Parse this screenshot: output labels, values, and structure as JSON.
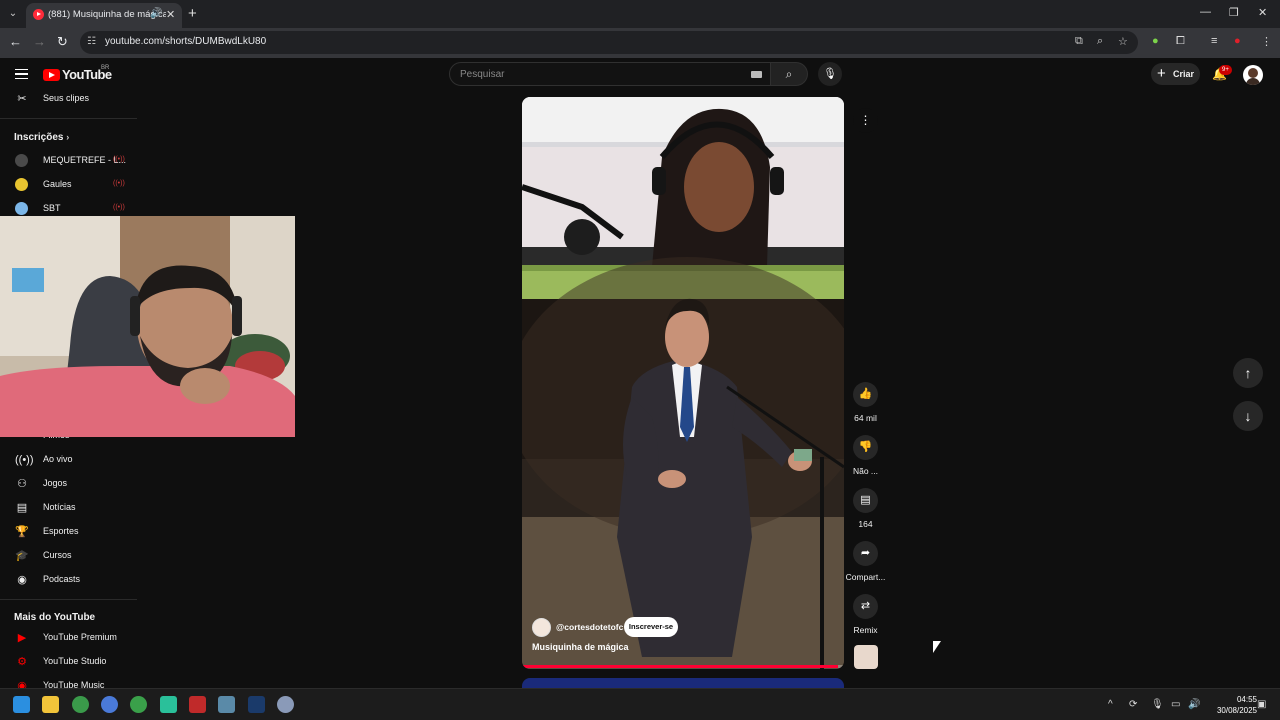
{
  "browser": {
    "tab_title": "(881) Musiquinha de mágica",
    "url": "youtube.com/shorts/DUMBwdLkU80"
  },
  "youtube": {
    "logo_text": "YouTube",
    "region": "BR",
    "search_placeholder": "Pesquisar",
    "create_label": "Criar",
    "notification_count": "9+"
  },
  "sidebar": {
    "top_item": "Seus clipes",
    "subscriptions_title": "Inscrições",
    "subscriptions": [
      {
        "name": "MEQUETREFE - L...",
        "color": "#4a4a4a"
      },
      {
        "name": "Gaules",
        "color": "#3aa0d8"
      },
      {
        "name": "SBT",
        "color": "#7bb6e8"
      }
    ],
    "explore_partial": "Filmes",
    "explore": [
      "Ao vivo",
      "Jogos",
      "Notícias",
      "Esportes",
      "Cursos",
      "Podcasts"
    ],
    "more_title": "Mais do YouTube",
    "more": [
      "YouTube Premium",
      "YouTube Studio",
      "YouTube Music"
    ]
  },
  "short": {
    "channel": "@cortesdotetofc",
    "subscribe_label": "Inscrever-se",
    "title": "Musiquinha de mágica",
    "progress": 0.98,
    "actions": {
      "likes": "64 mil",
      "dislike": "Não ...",
      "comments": "164",
      "share": "Compart...",
      "remix": "Remix"
    }
  },
  "taskbar": {
    "time": "04:55",
    "date": "30/08/2025"
  },
  "colors": {
    "brand_red": "#ff0000",
    "background": "#0f0f0f",
    "badge": "#cc0000"
  }
}
